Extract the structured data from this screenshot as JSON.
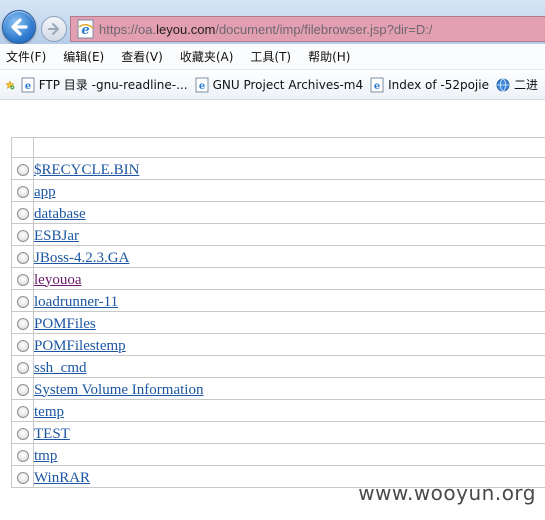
{
  "browser": {
    "address": {
      "url_prefix": "https://oa.",
      "url_host": "leyou.com",
      "url_suffix": "/document/imp/filebrowser.jsp?dir=D:/"
    },
    "menu": [
      "文件(F)",
      "编辑(E)",
      "查看(V)",
      "收藏夹(A)",
      "工具(T)",
      "帮助(H)"
    ],
    "favorites": [
      {
        "label": "FTP 目录 -gnu-readline-...",
        "icon": "page-icon"
      },
      {
        "label": "GNU Project Archives-m4",
        "icon": "page-icon"
      },
      {
        "label": "Index of -52pojie",
        "icon": "page-icon"
      },
      {
        "label": "二进",
        "icon": "globe-icon"
      }
    ]
  },
  "file_browser": {
    "entries": [
      {
        "name": "$RECYCLE.BIN",
        "visited": false
      },
      {
        "name": "app",
        "visited": false
      },
      {
        "name": "database",
        "visited": false
      },
      {
        "name": "ESBJar",
        "visited": false
      },
      {
        "name": "JBoss-4.2.3.GA",
        "visited": false
      },
      {
        "name": "leyouoa",
        "visited": true
      },
      {
        "name": "loadrunner-11",
        "visited": false
      },
      {
        "name": "POMFiles",
        "visited": false
      },
      {
        "name": "POMFilestemp",
        "visited": false
      },
      {
        "name": "ssh_cmd",
        "visited": false
      },
      {
        "name": "System Volume Information",
        "visited": false
      },
      {
        "name": "temp",
        "visited": false
      },
      {
        "name": "TEST",
        "visited": false
      },
      {
        "name": "tmp",
        "visited": false
      },
      {
        "name": "WinRAR",
        "visited": false
      }
    ]
  },
  "watermark": "www.wooyun.org",
  "colors": {
    "link": "#1c56a3",
    "link_visited": "#6a1b6b",
    "address_bar": "#e39fb2"
  }
}
